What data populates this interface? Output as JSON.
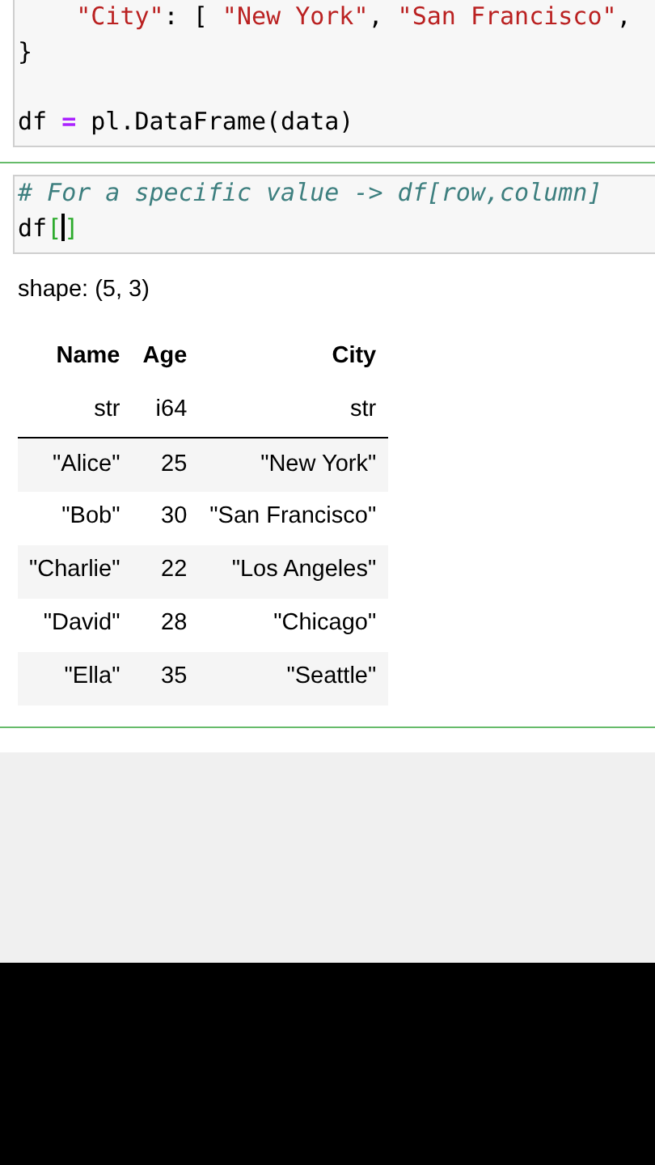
{
  "cells": [
    {
      "kind": "code",
      "lines": [
        {
          "indent": true,
          "gap_before": false,
          "tokens": [
            {
              "kind": "string",
              "text": "\"City\""
            },
            {
              "kind": "plain",
              "text": ": [ "
            },
            {
              "kind": "string",
              "text": "\"New York\""
            },
            {
              "kind": "plain",
              "text": ", "
            },
            {
              "kind": "string",
              "text": "\"San Francisco\""
            },
            {
              "kind": "plain",
              "text": ","
            }
          ]
        },
        {
          "indent": false,
          "gap_before": false,
          "tokens": [
            {
              "kind": "plain",
              "text": "}"
            }
          ]
        },
        {
          "indent": false,
          "gap_before": true,
          "tokens": [
            {
              "kind": "plain",
              "text": "df "
            },
            {
              "kind": "operator",
              "text": "="
            },
            {
              "kind": "plain",
              "text": " pl.DataFrame(data)"
            }
          ]
        }
      ]
    },
    {
      "kind": "code",
      "lines": [
        {
          "indent": false,
          "gap_before": false,
          "tokens": [
            {
              "kind": "comment",
              "text": "# For a specific value -> df[row,column]"
            }
          ]
        },
        {
          "indent": false,
          "gap_before": false,
          "tokens": [
            {
              "kind": "plain",
              "text": "df"
            },
            {
              "kind": "bracket",
              "text": "["
            },
            {
              "kind": "cursor"
            },
            {
              "kind": "bracket",
              "text": "]"
            }
          ]
        }
      ]
    }
  ],
  "output": {
    "shape": "shape: (5, 3)",
    "columns": [
      {
        "name": "Name",
        "dtype": "str"
      },
      {
        "name": "Age",
        "dtype": "i64"
      },
      {
        "name": "City",
        "dtype": "str"
      }
    ],
    "rows": [
      [
        "\"Alice\"",
        "25",
        "\"New York\""
      ],
      [
        "\"Bob\"",
        "30",
        "\"San Francisco\""
      ],
      [
        "\"Charlie\"",
        "22",
        "\"Los Angeles\""
      ],
      [
        "\"David\"",
        "28",
        "\"Chicago\""
      ],
      [
        "\"Ella\"",
        "35",
        "\"Seattle\""
      ]
    ]
  }
}
